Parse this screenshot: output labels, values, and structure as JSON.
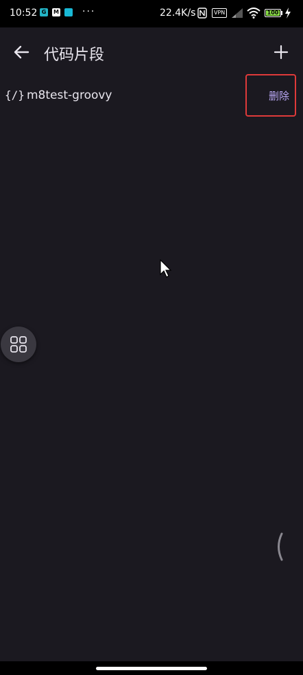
{
  "status_bar": {
    "time": "10:52",
    "notification_icons": [
      {
        "name": "app-notification-icon",
        "glyph": "G",
        "color": "#23b4c6"
      },
      {
        "name": "gmail-icon",
        "glyph": "M",
        "color": "#ffffff"
      },
      {
        "name": "app-notification-icon-2",
        "glyph": "",
        "color": "#19b9d6"
      }
    ],
    "more": "···",
    "net_speed": "22.4K/s",
    "vpn": "VPN",
    "battery": "100"
  },
  "app_bar": {
    "title": "代码片段",
    "back_icon": "arrow-left-icon",
    "add_icon": "plus-icon"
  },
  "snippets": [
    {
      "icon": "{/}",
      "name": "m8test-groovy",
      "delete_label": "删除"
    }
  ],
  "colors": {
    "background": "#1b1920",
    "accent": "#b9a8f4",
    "highlight_box": "#e03a3a"
  }
}
